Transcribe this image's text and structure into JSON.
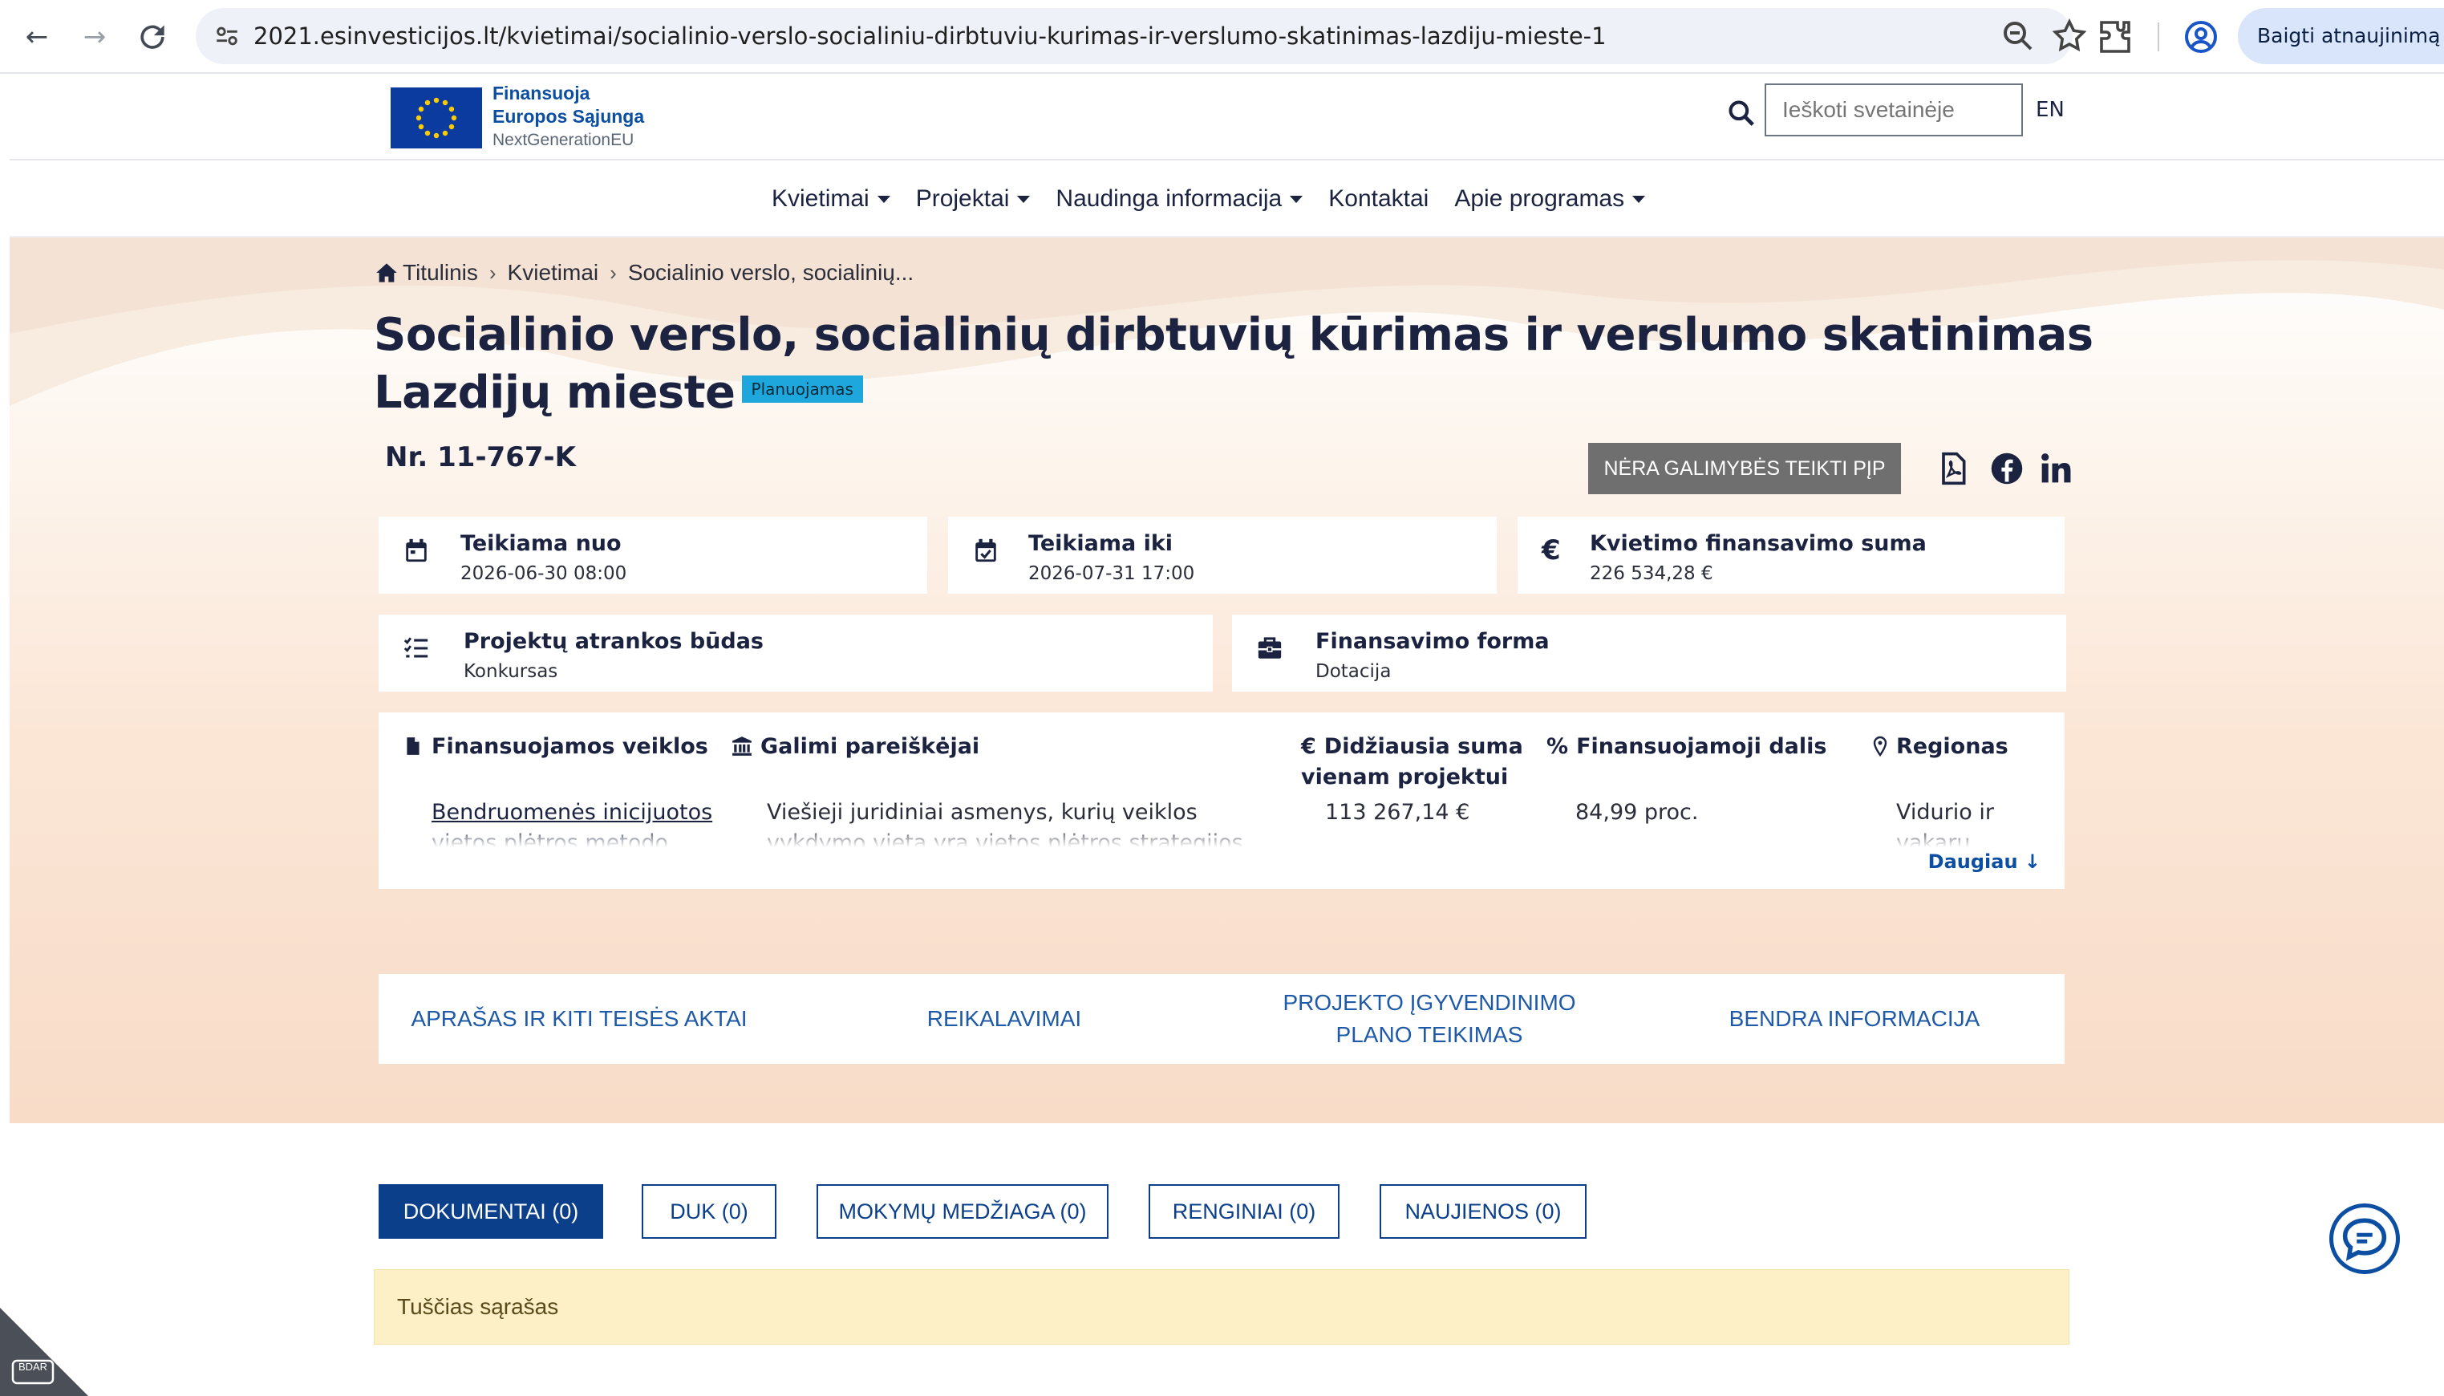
{
  "browser": {
    "url": "2021.esinvesticijos.lt/kvietimai/socialinio-verslo-socialiniu-dirbtuviu-kurimas-ir-verslumo-skatinimas-lazdiju-mieste-1",
    "update_button": "Baigti atnaujinimą"
  },
  "header": {
    "logo_line1": "Finansuoja",
    "logo_line2": "Europos Sąjunga",
    "logo_line3": "NextGenerationEU",
    "search_placeholder": "Ieškoti svetainėje",
    "language": "EN"
  },
  "nav": {
    "items": [
      {
        "label": "Kvietimai",
        "dropdown": true
      },
      {
        "label": "Projektai",
        "dropdown": true
      },
      {
        "label": "Naudinga informacija",
        "dropdown": true
      },
      {
        "label": "Kontaktai",
        "dropdown": false
      },
      {
        "label": "Apie programas",
        "dropdown": true
      }
    ]
  },
  "breadcrumb": {
    "home": "Titulinis",
    "level1": "Kvietimai",
    "current": "Socialinio verslo, socialinių..."
  },
  "call": {
    "title": "Socialinio verslo, socialinių dirbtuvių kūrimas ir verslumo skatinimas Lazdijų mieste",
    "status": "Planuojamas",
    "number": "Nr. 11-767-K",
    "submit_button": "NĖRA GALIMYBĖS TEIKTI PĮP"
  },
  "cards": {
    "submit_from": {
      "title": "Teikiama nuo",
      "value": "2026-06-30 08:00"
    },
    "submit_until": {
      "title": "Teikiama iki",
      "value": "2026-07-31 17:00"
    },
    "funding_amount": {
      "title": "Kvietimo finansavimo suma",
      "value": "226 534,28 €"
    },
    "selection_method": {
      "title": "Projektų atrankos būdas",
      "value": "Konkursas"
    },
    "funding_form": {
      "title": "Finansavimo forma",
      "value": "Dotacija"
    }
  },
  "funding_table": {
    "headers": {
      "activities": "Finansuojamos veiklos",
      "applicants": "Galimi pareiškėjai",
      "max_amount": "Didžiausia suma vienam projektui",
      "share": "Finansuojamoji dalis",
      "region": "Regionas"
    },
    "row": {
      "activities": "Bendruomenės inicijuotos vietos plėtros metodo (BIVP)",
      "applicants": "Viešieji juridiniai asmenys, kurių veiklos vykdymo vieta yra vietos plėtros strategijos įgyvendinimo",
      "max_amount": "113 267,14 €",
      "share": "84,99 proc.",
      "region": "Vidurio ir vakarų"
    },
    "more": "Daugiau"
  },
  "section_tabs": [
    "APRAŠAS IR KITI TEISĖS AKTAI",
    "REIKALAVIMAI",
    "PROJEKTO ĮGYVENDINIMO PLANO TEIKIMAS",
    "BENDRA INFORMACIJA"
  ],
  "doc_tabs": [
    "DOKUMENTAI (0)",
    "DUK (0)",
    "MOKYMŲ MEDŽIAGA (0)",
    "RENGINIAI (0)",
    "NAUJIENOS (0)"
  ],
  "empty_list": "Tuščias sąrašas",
  "corner_badge": "BDAR",
  "colors": {
    "brand_blue": "#0c3f8a",
    "link_blue": "#1e5aa8",
    "status_badge": "#1da7dc",
    "hero_peach": "#f8dcc8",
    "disabled_button": "#6f6f6f",
    "empty_notice": "#fdf0c6"
  }
}
